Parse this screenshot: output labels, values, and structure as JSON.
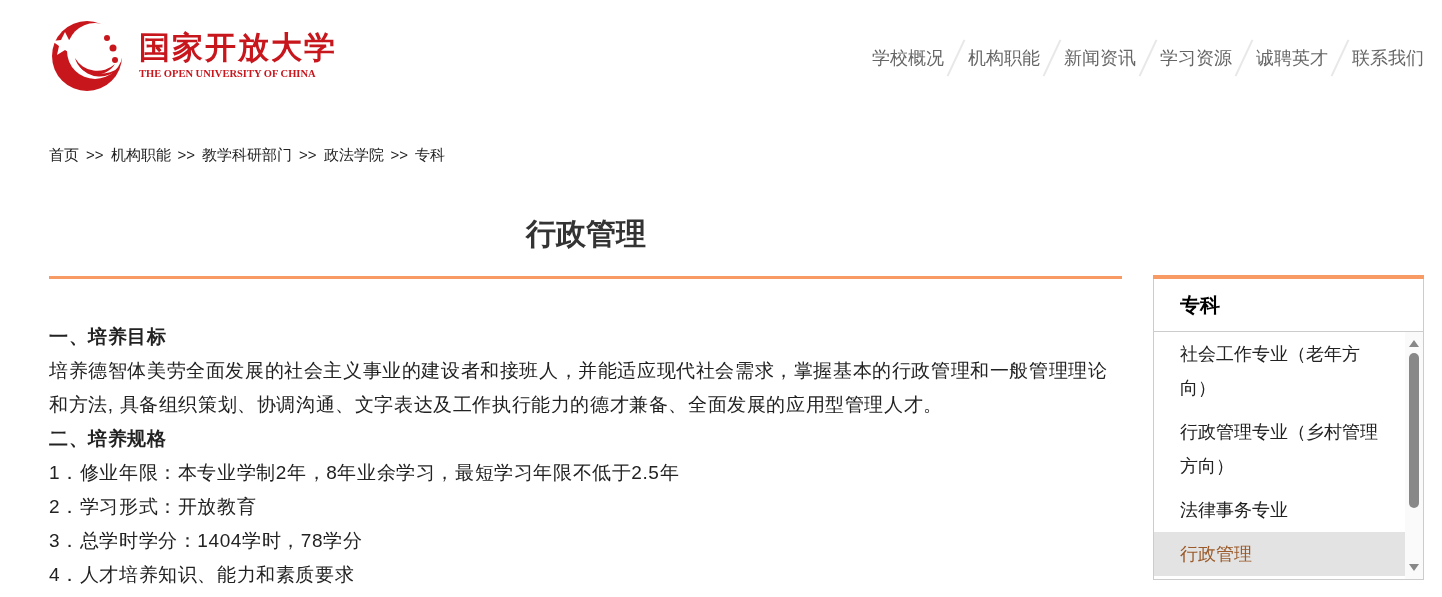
{
  "logo": {
    "title": "国家开放大学",
    "subtitle": "THE OPEN UNIVERSITY OF CHINA"
  },
  "nav": [
    {
      "label": "学校概况"
    },
    {
      "label": "机构职能"
    },
    {
      "label": "新闻资讯"
    },
    {
      "label": "学习资源"
    },
    {
      "label": "诚聘英才"
    },
    {
      "label": "联系我们"
    }
  ],
  "breadcrumb": [
    {
      "label": "首页",
      "separator": ">>"
    },
    {
      "label": "机构职能",
      "separator": ">>"
    },
    {
      "label": "教学科研部门",
      "separator": ">>"
    },
    {
      "label": "政法学院",
      "separator": ">>"
    },
    {
      "label": "专科"
    }
  ],
  "article": {
    "title": "行政管理",
    "blocks": [
      {
        "kind": "heading",
        "text": "一、培养目标"
      },
      {
        "kind": "paragraph",
        "text": "培养德智体美劳全面发展的社会主义事业的建设者和接班人，并能适应现代社会需求，掌握基本的行政管理和一般管理理论和方法, 具备组织策划、协调沟通、文字表达及工作执行能力的德才兼备、全面发展的应用型管理人才。"
      },
      {
        "kind": "heading",
        "text": "二、培养规格"
      },
      {
        "kind": "paragraph",
        "text": "1．修业年限：本专业学制2年，8年业余学习，最短学习年限不低于2.5年"
      },
      {
        "kind": "paragraph",
        "text": "2．学习形式：开放教育"
      },
      {
        "kind": "paragraph",
        "text": "3．总学时学分：1404学时，78学分"
      },
      {
        "kind": "paragraph",
        "text": "4．人才培养知识、能力和素质要求"
      }
    ]
  },
  "sidebar": {
    "title": "专科",
    "items": [
      {
        "label": "社会工作专业（老年方向）",
        "selected": false
      },
      {
        "label": "行政管理专业（乡村管理方向）",
        "selected": false
      },
      {
        "label": "法律事务专业",
        "selected": false
      },
      {
        "label": "行政管理",
        "selected": true
      }
    ]
  }
}
